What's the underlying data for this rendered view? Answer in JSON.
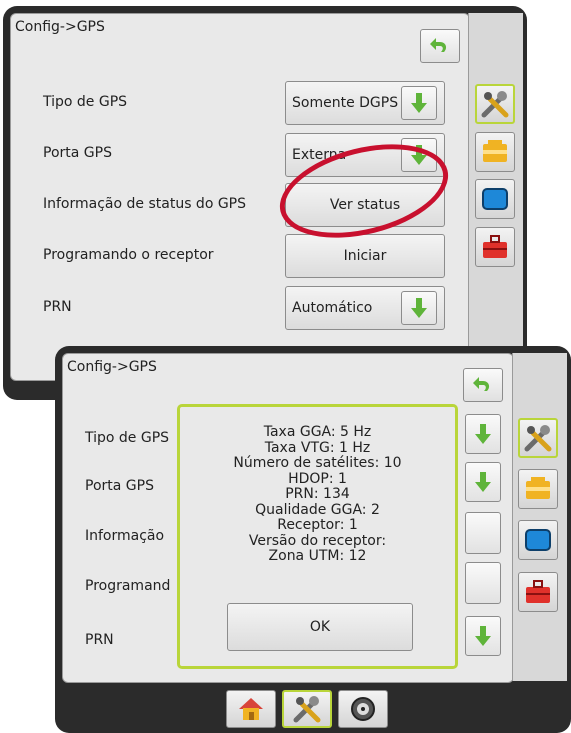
{
  "colors": {
    "accent": "#b9d53a",
    "highlight_circle": "#c8102e",
    "arrow_green": "#5fb43a"
  },
  "back_screen": {
    "title": "Config->GPS",
    "rows": [
      {
        "label": "Tipo de GPS",
        "value": "Somente DGPS",
        "has_arrow": true
      },
      {
        "label": "Porta GPS",
        "value": "Externa",
        "has_arrow": true
      },
      {
        "label": "Informação de status do GPS",
        "value": "Ver status",
        "has_arrow": false
      },
      {
        "label": "Programando o receptor",
        "value": "Iniciar",
        "has_arrow": false
      },
      {
        "label": "PRN",
        "value": "Automático",
        "has_arrow": true
      }
    ]
  },
  "front_screen": {
    "title": "Config->GPS",
    "rows": [
      {
        "label": "Tipo de GPS"
      },
      {
        "label": "Porta GPS"
      },
      {
        "label": "Informação"
      },
      {
        "label": "Programand"
      },
      {
        "label": "PRN"
      }
    ],
    "status_dialog": {
      "lines": [
        "Taxa GGA: 5 Hz",
        "Taxa VTG: 1 Hz",
        "Número de satélites: 10",
        "HDOP: 1",
        "PRN: 134",
        "Qualidade GGA: 2",
        "Receptor: 1",
        "Versão do receptor:",
        "Zona UTM: 12"
      ],
      "ok_label": "OK"
    }
  },
  "icons": {
    "back": "back-arrow-icon",
    "dropdown": "green-down-arrow-icon",
    "tools": "tools-icon",
    "implement": "implement-icon",
    "display": "display-icon",
    "toolbox": "toolbox-icon",
    "home": "home-icon",
    "gauge": "gauge-icon"
  }
}
